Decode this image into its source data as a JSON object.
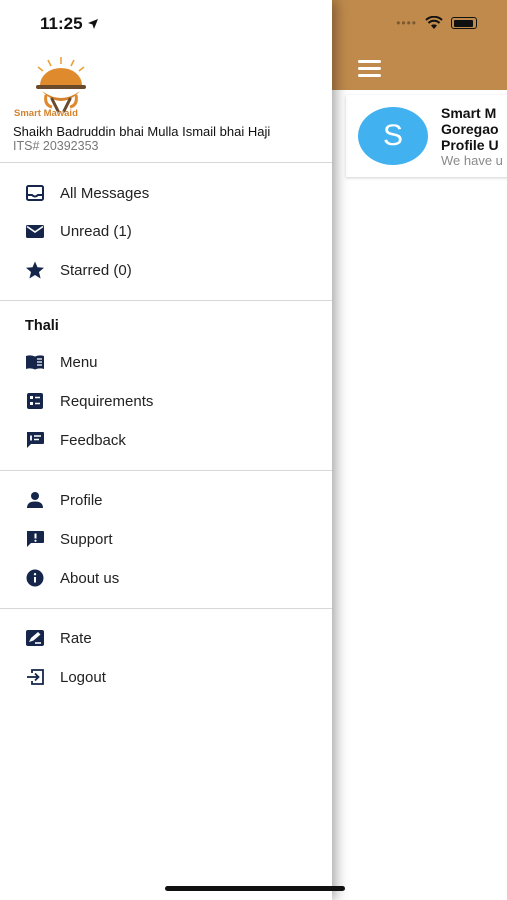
{
  "status_bar": {
    "time": "11:25"
  },
  "drawer": {
    "app_name": "Smart Mawaid",
    "user": {
      "name": "Shaikh Badruddin bhai Mulla Ismail bhai Haji",
      "its": "ITS# 20392353"
    },
    "messages": [
      {
        "label": "All Messages",
        "icon": "inbox-icon"
      },
      {
        "label": "Unread (1)",
        "icon": "mail-icon"
      },
      {
        "label": "Starred (0)",
        "icon": "star-icon"
      }
    ],
    "thali": {
      "title": "Thali",
      "items": [
        {
          "label": "Menu",
          "icon": "book-icon"
        },
        {
          "label": "Requirements",
          "icon": "checklist-icon"
        },
        {
          "label": "Feedback",
          "icon": "feedback-icon"
        }
      ]
    },
    "account": [
      {
        "label": "Profile",
        "icon": "person-icon"
      },
      {
        "label": "Support",
        "icon": "support-icon"
      },
      {
        "label": "About us",
        "icon": "info-icon"
      }
    ],
    "other": [
      {
        "label": "Rate",
        "icon": "rate-icon"
      },
      {
        "label": "Logout",
        "icon": "logout-icon"
      }
    ]
  },
  "main": {
    "message": {
      "avatar_letter": "S",
      "title_lines": [
        "Smart M",
        "Goregao",
        "Profile U"
      ],
      "preview": "We have u"
    }
  },
  "colors": {
    "brand": "#bf8a4c",
    "avatar": "#41b1f0",
    "icon": "#15264a"
  }
}
